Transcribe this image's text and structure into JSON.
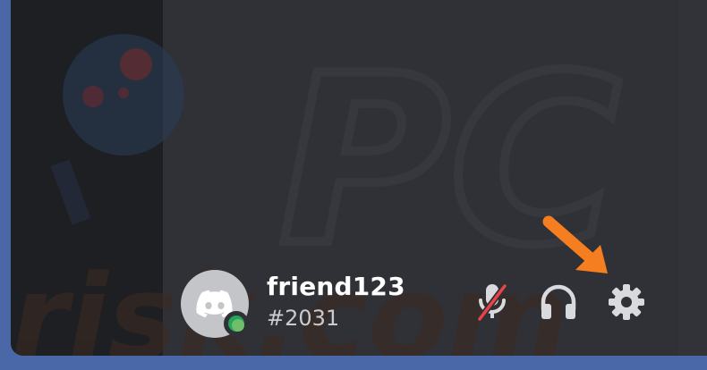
{
  "user": {
    "username": "friend123",
    "discriminator": "#2031",
    "status": "online"
  },
  "controls": {
    "mute": {
      "icon": "microphone-muted-icon",
      "state": "muted"
    },
    "deafen": {
      "icon": "headphones-icon"
    },
    "settings": {
      "icon": "gear-icon"
    }
  },
  "watermark": {
    "text_top": "PC",
    "text_bottom": "risk.com"
  },
  "colors": {
    "page_bg": "#4a67a8",
    "panel_bg": "#2f3136",
    "rail_bg": "#1e1f22",
    "status_online": "#23a55a",
    "mute_slash": "#ed4245",
    "arrow": "#f57f20",
    "icon": "#d9dadd"
  }
}
